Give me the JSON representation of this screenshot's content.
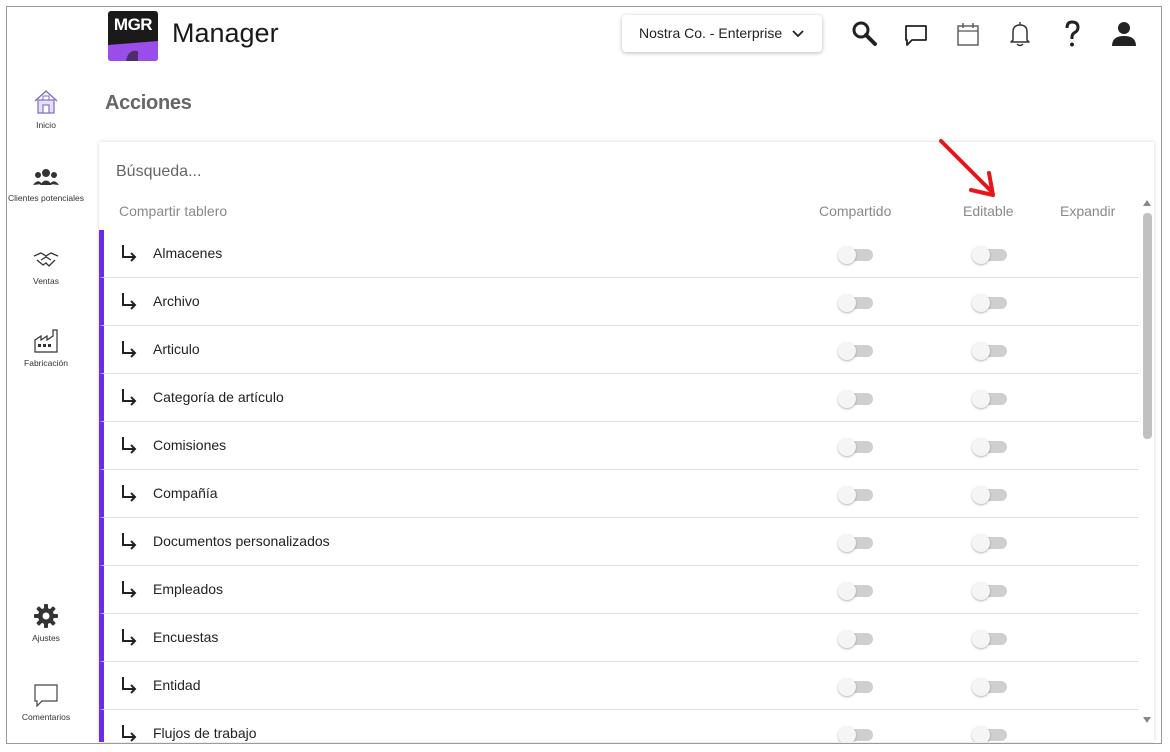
{
  "header": {
    "logo_text": "MGR",
    "app_title": "Manager",
    "company_selector": "Nostra Co. - Enterprise",
    "icons": [
      "search-icon",
      "chat-icon",
      "calendar-icon",
      "bell-icon",
      "help-icon",
      "user-icon"
    ]
  },
  "sidebar": {
    "items": [
      {
        "label": "Inicio",
        "icon": "home-icon"
      },
      {
        "label": "Clientes potenciales",
        "icon": "people-icon"
      },
      {
        "label": "Ventas",
        "icon": "handshake-icon"
      },
      {
        "label": "Fabricación",
        "icon": "factory-icon"
      },
      {
        "label": "Ajustes",
        "icon": "gear-icon"
      },
      {
        "label": "Comentarios",
        "icon": "comment-icon"
      }
    ]
  },
  "page": {
    "title": "Acciones",
    "search_placeholder": "Búsqueda...",
    "columns": {
      "share_board": "Compartir tablero",
      "shared": "Compartido",
      "editable": "Editable",
      "expand": "Expandir"
    },
    "rows": [
      {
        "name": "Almacenes",
        "shared": false,
        "editable": false
      },
      {
        "name": "Archivo",
        "shared": false,
        "editable": false
      },
      {
        "name": "Articulo",
        "shared": false,
        "editable": false
      },
      {
        "name": "Categoría de artículo",
        "shared": false,
        "editable": false
      },
      {
        "name": "Comisiones",
        "shared": false,
        "editable": false
      },
      {
        "name": "Compañía",
        "shared": false,
        "editable": false
      },
      {
        "name": "Documentos personalizados",
        "shared": false,
        "editable": false
      },
      {
        "name": "Empleados",
        "shared": false,
        "editable": false
      },
      {
        "name": "Encuestas",
        "shared": false,
        "editable": false
      },
      {
        "name": "Entidad",
        "shared": false,
        "editable": false
      },
      {
        "name": "Flujos de trabajo",
        "shared": false,
        "editable": false
      }
    ]
  },
  "colors": {
    "accent": "#6a2ce8",
    "annotation_arrow": "#e8161b"
  }
}
